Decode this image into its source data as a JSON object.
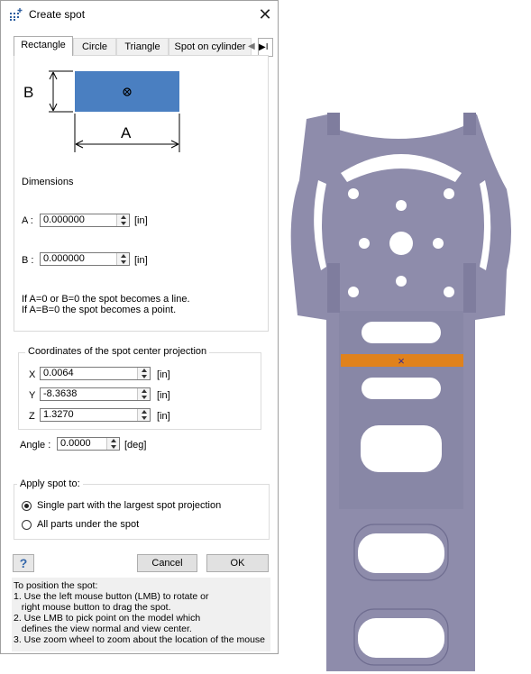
{
  "dialog": {
    "title": "Create spot",
    "tabs": [
      "Rectangle",
      "Circle",
      "Triangle",
      "Spot on cylinder"
    ],
    "tab_overflow": "I",
    "diagram": {
      "label_a": "A",
      "label_b": "B",
      "fill_color": "#4a7fc1"
    },
    "dimensions_label": "Dimensions",
    "a_label": "A :",
    "a_value": "0.000000",
    "b_label": "B :",
    "b_value": "0.000000",
    "unit": "[in]",
    "note_line1": "If A=0 or B=0 the spot becomes a line.",
    "note_line2": "If A=B=0 the spot becomes a point.",
    "coords_title": "Coordinates of the spot center projection",
    "coords": [
      {
        "axis": "X",
        "value": "0.0064",
        "unit": "[in]"
      },
      {
        "axis": "Y",
        "value": "-8.3638",
        "unit": "[in]"
      },
      {
        "axis": "Z",
        "value": "1.3270",
        "unit": "[in]"
      }
    ],
    "angle_label": "Angle :",
    "angle_value": "0.0000",
    "angle_unit": "[deg]",
    "apply_title": "Apply spot to:",
    "apply_options": [
      {
        "label": "Single part with the largest spot projection",
        "selected": true
      },
      {
        "label": "All parts under the spot",
        "selected": false
      }
    ],
    "help_glyph": "?",
    "cancel_label": "Cancel",
    "ok_label": "OK",
    "help_lines": [
      "To position the spot:",
      "1. Use the left mouse button (LMB) to rotate or",
      "   right mouse button to drag the spot.",
      "2. Use LMB to pick point on the model which",
      "   defines the view normal and view center.",
      "3. Use zoom wheel to zoom about the location of the mouse"
    ]
  },
  "viewport": {
    "part_color": "#8e8cab",
    "spot_color": "#e0821c",
    "spot_marker": "×"
  }
}
